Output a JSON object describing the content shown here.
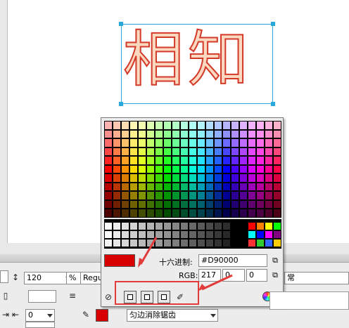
{
  "canvas": {
    "art_text": "相知"
  },
  "toolbar": {
    "font_style_value": "Regul",
    "leading_value": "120",
    "leading_unit": "%",
    "indent_value": "0",
    "spacing_value": "0",
    "antialias_value": "匀边消除锯齿",
    "mode_label": "常",
    "fill_color": "#d90000"
  },
  "color_picker": {
    "hex_label": "十六进制:",
    "hex_value": "#D90000",
    "rgb_label": "RGB:",
    "r_value": "217",
    "g_value": "0",
    "b_value": "0",
    "preview_color": "#d90000",
    "highlight_color": "#e23b3b"
  },
  "icons": {
    "eyedropper": "eyedropper-icon",
    "copy": "copy-icon",
    "color_wheel": "color-wheel-icon"
  }
}
